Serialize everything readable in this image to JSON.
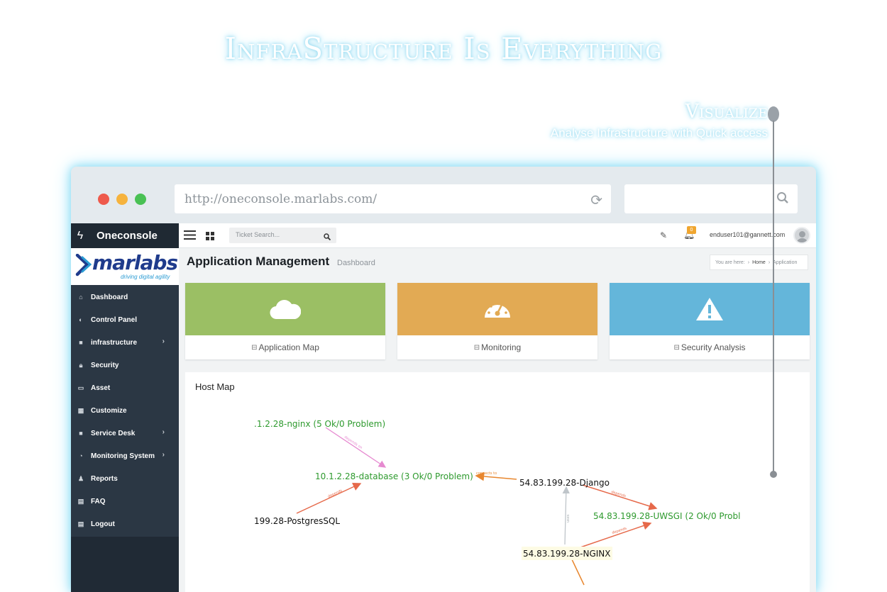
{
  "hero": {
    "title": "InfraStructure Is Everything"
  },
  "callout": {
    "title": "Visualize",
    "subtitle": "Analyse Infrastructure with Quick access"
  },
  "browser": {
    "url": "http://oneconsole.marlabs.com/"
  },
  "app": {
    "brand": "Oneconsole",
    "logo_text": "marlabs",
    "logo_tagline": "driving digital agility",
    "search_placeholder": "Ticket Search...",
    "notification_count": "0",
    "user_email": "enduser101@gannett.com"
  },
  "sidebar": {
    "items": [
      {
        "label": "Dashboard",
        "icon": "home-icon"
      },
      {
        "label": "Control Panel",
        "icon": "toggle-icon"
      },
      {
        "label": "infrastructure",
        "icon": "briefcase-icon",
        "has_children": true
      },
      {
        "label": "Security",
        "icon": "lock-icon"
      },
      {
        "label": "Asset",
        "icon": "laptop-icon"
      },
      {
        "label": "Customize",
        "icon": "grid-icon"
      },
      {
        "label": "Service Desk",
        "icon": "briefcase-icon",
        "has_children": true
      },
      {
        "label": "Monitoring System",
        "icon": "dashboard-icon",
        "has_children": true
      },
      {
        "label": "Reports",
        "icon": "user-icon"
      },
      {
        "label": "FAQ",
        "icon": "calendar-icon"
      },
      {
        "label": "Logout",
        "icon": "calendar-icon"
      }
    ]
  },
  "page": {
    "title": "Application Management",
    "subtitle": "Dashboard",
    "breadcrumb": {
      "prefix": "You are here:",
      "home": "Home",
      "current": "Application"
    }
  },
  "cards": [
    {
      "label": "Application Map",
      "icon": "cloud-icon",
      "color": "#9bbf64"
    },
    {
      "label": "Monitoring",
      "icon": "gauge-icon",
      "color": "#e2aa54"
    },
    {
      "label": "Security Analysis",
      "icon": "warning-icon",
      "color": "#64b6da"
    }
  ],
  "host_map": {
    "title": "Host Map",
    "nodes": [
      {
        "label": ".1.2.28-nginx (5 Ok/0 Problem)",
        "status": "ok"
      },
      {
        "label": "10.1.2.28-database (3 Ok/0 Problem)",
        "status": "ok"
      },
      {
        "label": "54.83.199.28-Django",
        "status": "plain"
      },
      {
        "label": "199.28-PostgresSQL",
        "status": "plain"
      },
      {
        "label": "54.83.199.28-UWSGI (2 Ok/0 Probl",
        "status": "ok"
      },
      {
        "label": "54.83.199.28-NGINX",
        "status": "plain"
      }
    ],
    "edges": [
      {
        "label": "depends on",
        "color": "#e68ad0"
      },
      {
        "label": "connects to",
        "color": "#e8872f"
      },
      {
        "label": "depends",
        "color": "#e6694a"
      },
      {
        "label": "depends",
        "color": "#e6694a"
      },
      {
        "label": "depends",
        "color": "#e6694a"
      },
      {
        "label": "uses",
        "color": "#bfc5ca"
      }
    ]
  }
}
